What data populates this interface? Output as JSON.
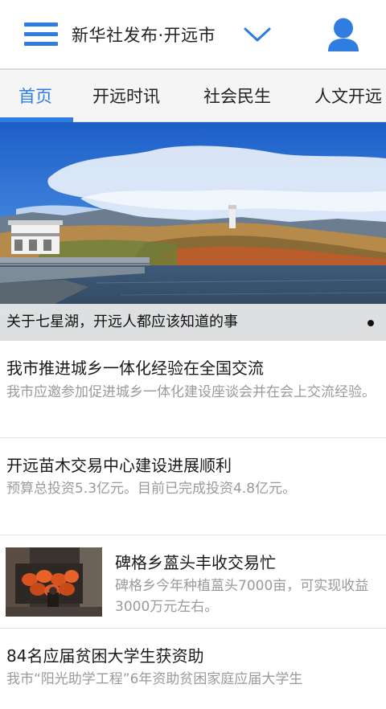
{
  "header": {
    "title": "新华社发布·开远市",
    "menu_icon": "menu-icon",
    "dropdown_icon": "chevron-down-icon",
    "user_icon": "user-icon",
    "accent_color": "#2f7de1"
  },
  "tabs": [
    {
      "label": "首页",
      "active": true
    },
    {
      "label": "开远时讯",
      "active": false
    },
    {
      "label": "社会民生",
      "active": false
    },
    {
      "label": "人文开远",
      "active": false
    }
  ],
  "banner": {
    "caption": "关于七星湖，开远人都应该知道的事",
    "page_count": 1,
    "current_page": 1
  },
  "news": [
    {
      "title": "我市推进城乡一体化经验在全国交流",
      "summary": "我市应邀参加促进城乡一体化建设座谈会并在会上交流经验。",
      "has_thumbnail": false
    },
    {
      "title": "开远苗木交易中心建设进展顺利",
      "summary": "预算总投资5.3亿元。目前已完成投资4.8亿元。",
      "has_thumbnail": false
    },
    {
      "title": "碑格乡蒕头丰收交易忙",
      "summary": "碑格乡今年种植蒕头7000亩，可实现收益3000万元左右。",
      "has_thumbnail": true
    },
    {
      "title": "84名应届贫困大学生获资助",
      "summary": "我市“阳光助学工程”6年资助贫困家庭应届大学生",
      "has_thumbnail": false
    }
  ]
}
